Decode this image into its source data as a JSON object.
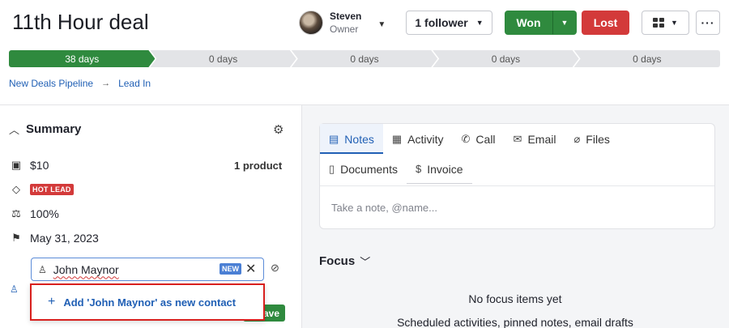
{
  "deal": {
    "title": "11th Hour deal"
  },
  "owner": {
    "name": "Steven",
    "role": "Owner"
  },
  "header": {
    "follower_label": "1 follower",
    "won_label": "Won",
    "lost_label": "Lost",
    "more_label": "···"
  },
  "pipeline": {
    "stages": [
      {
        "label": "38 days",
        "active": true
      },
      {
        "label": "0 days",
        "active": false
      },
      {
        "label": "0 days",
        "active": false
      },
      {
        "label": "0 days",
        "active": false
      },
      {
        "label": "0 days",
        "active": false
      }
    ]
  },
  "breadcrumb": {
    "pipeline": "New Deals Pipeline",
    "stage": "Lead In",
    "separator": "→"
  },
  "summary": {
    "title": "Summary",
    "value": "$10",
    "products": "1 product",
    "label": "HOT LEAD",
    "probability": "100%",
    "close_date": "May 31, 2023"
  },
  "contact_field": {
    "value": "John Maynor",
    "badge": "NEW",
    "suggestion": "Add 'John Maynor' as new contact",
    "save_partial": "ave"
  },
  "tabs": {
    "row1": [
      {
        "label": "Notes",
        "icon": "note-icon",
        "glyph": "▤",
        "active": true
      },
      {
        "label": "Activity",
        "icon": "calendar-icon",
        "glyph": "▦",
        "active": false
      },
      {
        "label": "Call",
        "icon": "phone-icon",
        "glyph": "✆",
        "active": false
      },
      {
        "label": "Email",
        "icon": "envelope-icon",
        "glyph": "✉",
        "active": false
      },
      {
        "label": "Files",
        "icon": "paperclip-icon",
        "glyph": "⌀",
        "active": false
      }
    ],
    "row2": [
      {
        "label": "Documents",
        "icon": "document-icon",
        "glyph": "▯",
        "active": false
      },
      {
        "label": "Invoice",
        "icon": "invoice-icon",
        "glyph": "$",
        "active": false
      }
    ]
  },
  "notes": {
    "placeholder": "Take a note, @name..."
  },
  "focus": {
    "title": "Focus",
    "empty": "No focus items yet",
    "subtitle": "Scheduled activities, pinned notes, email drafts"
  },
  "colors": {
    "won": "#2f8a3e",
    "lost": "#d33a3a",
    "link": "#2160b5",
    "highlight": "#d8201e"
  }
}
